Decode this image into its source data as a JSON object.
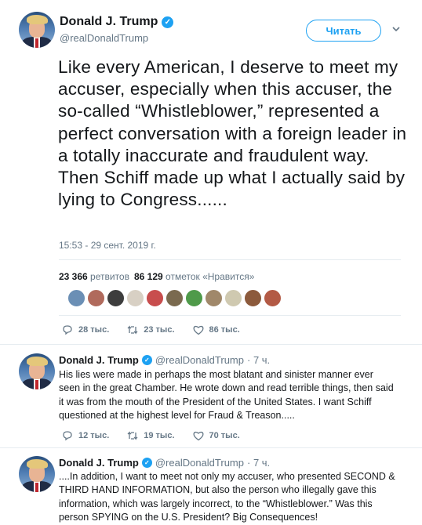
{
  "main": {
    "display_name": "Donald J. Trump",
    "handle": "@realDonaldTrump",
    "follow_label": "Читать",
    "text": "Like every American, I deserve to meet my accuser, especially when this accuser, the so-called “Whistleblower,” represented a perfect conversation with a foreign leader in a totally inaccurate and fraudulent way. Then Schiff made up what I actually said by lying to Congress......",
    "timestamp": "15:53 - 29 сент. 2019 г.",
    "retweets_count": "23 366",
    "retweets_label": "ретвитов",
    "likes_count": "86 129",
    "likes_label": "отметок «Нравится»",
    "reply_count": "28 тыс.",
    "retweet_count_short": "23 тыс.",
    "like_count_short": "86 тыс."
  },
  "liker_colors": [
    "#6b8fb5",
    "#b06a5c",
    "#3d3d3d",
    "#d8d0c4",
    "#c84d4d",
    "#7a6a4f",
    "#4f9a4a",
    "#a0886a",
    "#cfc9b0",
    "#8c5a3c",
    "#b35a45"
  ],
  "replies": [
    {
      "display_name": "Donald J. Trump",
      "handle": "@realDonaldTrump",
      "time": "· 7 ч.",
      "text": "His lies were made in perhaps the most blatant and sinister manner ever seen in the great Chamber. He wrote down and read terrible things, then said it was from the mouth of the President of the United States. I want Schiff questioned at the highest level for Fraud & Treason.....",
      "reply_count": "12 тыс.",
      "retweet_count": "19 тыс.",
      "like_count": "70 тыс."
    },
    {
      "display_name": "Donald J. Trump",
      "handle": "@realDonaldTrump",
      "time": "· 7 ч.",
      "text": "....In addition, I want to meet not only my accuser, who presented SECOND & THIRD HAND INFORMATION, but also the person who illegally gave this information, which was largely incorrect, to the “Whistleblower.” Was this person SPYING on the U.S. President? Big Consequences!"
    }
  ],
  "colors": {
    "accent": "#1da1f2",
    "muted": "#657786",
    "text": "#14171a"
  }
}
